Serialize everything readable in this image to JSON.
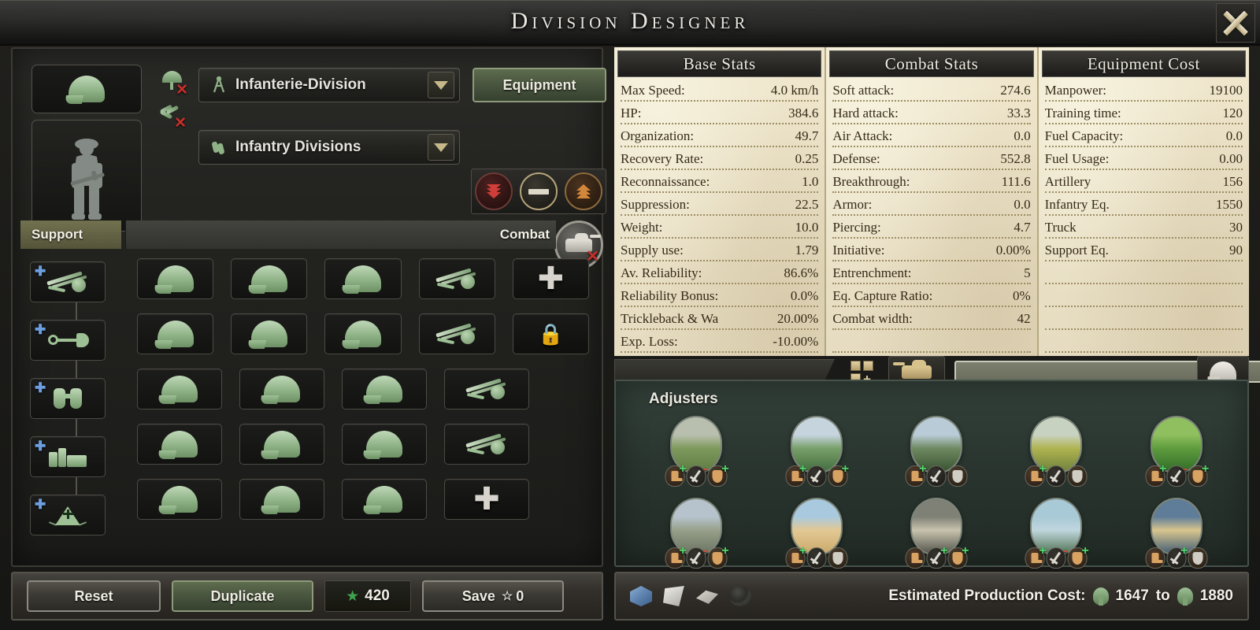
{
  "window": {
    "title": "Division Designer",
    "close_icon": "close-x-icon"
  },
  "designer": {
    "division_icon": "helmet-icon",
    "portrait": "infantry-soldier-portrait",
    "specialization_toggles": [
      {
        "name": "paratrooper-toggle",
        "icon": "parachute-icon",
        "disabled_mark": "✕"
      },
      {
        "name": "marine-toggle",
        "icon": "marine-wings-icon",
        "disabled_mark": "✕"
      }
    ],
    "template_dropdown": {
      "icon": "divider-caliper-icon",
      "value": "Infanterie-Division",
      "arrow": "chevron-down-icon"
    },
    "category_dropdown": {
      "icon": "dogtag-icon",
      "value": "Infantry Divisions",
      "arrow": "chevron-down-icon"
    },
    "equipment_button": "Equipment",
    "priority_buttons": [
      {
        "name": "priority-low",
        "icon": "double-chevron-down-icon",
        "selected": false
      },
      {
        "name": "priority-normal",
        "icon": "dash-in-ring-icon",
        "selected": false
      },
      {
        "name": "priority-high",
        "icon": "double-chevron-up-icon",
        "selected": false
      }
    ],
    "tank_designer_toggle": {
      "icon": "tank-icon",
      "disabled_mark": "✕"
    },
    "tabs": {
      "support": "Support",
      "combat": "Combat"
    }
  },
  "support_column": [
    {
      "name": "support-slot-artillery",
      "icon": "artillery-icon",
      "add_badge": "✚"
    },
    {
      "name": "support-slot-engineer",
      "icon": "shovel-icon",
      "add_badge": "✚"
    },
    {
      "name": "support-slot-recon",
      "icon": "binoculars-icon",
      "add_badge": "✚"
    },
    {
      "name": "support-slot-logistics",
      "icon": "supply-crates-icon",
      "add_badge": "✚"
    },
    {
      "name": "support-slot-field-hospital",
      "icon": "medical-tent-icon",
      "add_badge": "✚"
    }
  ],
  "combat_grid": {
    "rows": [
      {
        "cells": [
          "infantry",
          "infantry",
          "infantry",
          "artillery",
          "add"
        ]
      },
      {
        "cells": [
          "infantry",
          "infantry",
          "infantry",
          "artillery",
          "locked"
        ]
      },
      {
        "cells": [
          "infantry",
          "infantry",
          "infantry",
          "artillery"
        ]
      },
      {
        "cells": [
          "infantry",
          "infantry",
          "infantry",
          "artillery"
        ]
      },
      {
        "cells": [
          "infantry",
          "infantry",
          "infantry",
          "add"
        ]
      }
    ],
    "glyphs": {
      "infantry": "helmet-icon",
      "artillery": "artillery-icon",
      "add": "✚",
      "locked": "🔒"
    }
  },
  "stats": {
    "columns": [
      {
        "title": "Base Stats",
        "rows": [
          {
            "label": "Max Speed:",
            "value": "4.0 km/h"
          },
          {
            "label": "HP:",
            "value": "384.6"
          },
          {
            "label": "Organization:",
            "value": "49.7"
          },
          {
            "label": "Recovery Rate:",
            "value": "0.25"
          },
          {
            "label": "Reconnaissance:",
            "value": "1.0"
          },
          {
            "label": "Suppression:",
            "value": "22.5"
          },
          {
            "label": "Weight:",
            "value": "10.0"
          },
          {
            "label": "Supply use:",
            "value": "1.79"
          },
          {
            "label": "Av. Reliability:",
            "value": "86.6%"
          },
          {
            "label": "Reliability Bonus:",
            "value": "0.0%"
          },
          {
            "label": "Trickleback & Wa",
            "value": "20.00%"
          },
          {
            "label": "Exp. Loss:",
            "value": "-10.00%"
          }
        ]
      },
      {
        "title": "Combat Stats",
        "rows": [
          {
            "label": "Soft attack:",
            "value": "274.6"
          },
          {
            "label": "Hard attack:",
            "value": "33.3"
          },
          {
            "label": "Air Attack:",
            "value": "0.0"
          },
          {
            "label": "Defense:",
            "value": "552.8"
          },
          {
            "label": "Breakthrough:",
            "value": "111.6"
          },
          {
            "label": "Armor:",
            "value": "0.0"
          },
          {
            "label": "Piercing:",
            "value": "4.7"
          },
          {
            "label": "Initiative:",
            "value": "0.00%"
          },
          {
            "label": "Entrenchment:",
            "value": "5"
          },
          {
            "label": "Eq. Capture Ratio:",
            "value": "0%"
          },
          {
            "label": "Combat width:",
            "value": "42"
          },
          {
            "label": "",
            "value": ""
          }
        ]
      },
      {
        "title": "Equipment Cost",
        "rows": [
          {
            "label": "Manpower:",
            "value": "19100"
          },
          {
            "label": "Training time:",
            "value": "120"
          },
          {
            "label": "Fuel Capacity:",
            "value": "0.0"
          },
          {
            "label": "Fuel Usage:",
            "value": "0.00"
          },
          {
            "label": "Artillery",
            "value": "156"
          },
          {
            "label": "Infantry Eq.",
            "value": "1550"
          },
          {
            "label": "Truck",
            "value": "30"
          },
          {
            "label": "Support Eq.",
            "value": "90"
          },
          {
            "label": "",
            "value": ""
          },
          {
            "label": "",
            "value": ""
          },
          {
            "label": "",
            "value": ""
          },
          {
            "label": "",
            "value": ""
          }
        ]
      }
    ]
  },
  "adjusters_tabbar": {
    "grid_add_icon": "grid-add-icon",
    "tank_tab_icon": "tank-icon",
    "progress_bar": "equipment-progress-bar",
    "helmet_tab_icon": "helmet-icon"
  },
  "adjusters": {
    "title": "Adjusters",
    "terrains": [
      {
        "name": "plains",
        "colors": [
          "#b8bfae",
          "#7f9a5c",
          "#5d7a42"
        ],
        "badges": [
          {
            "icon": "boot-icon",
            "sign": "+"
          },
          {
            "icon": "sword-icon",
            "sign": "-"
          },
          {
            "icon": "shield-icon",
            "sign": "+",
            "tan": true
          }
        ]
      },
      {
        "name": "hills",
        "colors": [
          "#c6d4de",
          "#79a06a",
          "#3f6b3c"
        ],
        "badges": [
          {
            "icon": "boot-icon",
            "sign": "+"
          },
          {
            "icon": "sword-icon",
            "sign": ""
          },
          {
            "icon": "shield-icon",
            "sign": "+",
            "tan": true
          }
        ]
      },
      {
        "name": "mountain",
        "colors": [
          "#b9cbd6",
          "#6f8a62",
          "#36502f"
        ],
        "badges": [
          {
            "icon": "boot-icon",
            "sign": "+"
          },
          {
            "icon": "sword-icon",
            "sign": ""
          },
          {
            "icon": "shield-icon",
            "sign": ""
          }
        ]
      },
      {
        "name": "marsh",
        "colors": [
          "#c8d2c0",
          "#b0b451",
          "#6d7f3b"
        ],
        "badges": [
          {
            "icon": "boot-icon",
            "sign": "+"
          },
          {
            "icon": "sword-icon",
            "sign": ""
          },
          {
            "icon": "shield-icon",
            "sign": ""
          }
        ]
      },
      {
        "name": "forest",
        "colors": [
          "#8fbf5e",
          "#5f9c3e",
          "#2f6b27"
        ],
        "badges": [
          {
            "icon": "boot-icon",
            "sign": "+"
          },
          {
            "icon": "sword-icon",
            "sign": "-"
          },
          {
            "icon": "shield-icon",
            "sign": "+",
            "tan": true
          }
        ]
      },
      {
        "name": "urban",
        "colors": [
          "#b6c3cc",
          "#97a08a",
          "#6a7360"
        ],
        "badges": [
          {
            "icon": "boot-icon",
            "sign": "+"
          },
          {
            "icon": "sword-icon",
            "sign": "-"
          },
          {
            "icon": "shield-icon",
            "sign": "+",
            "tan": true
          }
        ]
      },
      {
        "name": "desert",
        "colors": [
          "#a9cade",
          "#e3c894",
          "#c9a969"
        ],
        "badges": [
          {
            "icon": "boot-icon",
            "sign": "+"
          },
          {
            "icon": "sword-icon",
            "sign": ""
          },
          {
            "icon": "shield-icon",
            "sign": ""
          }
        ]
      },
      {
        "name": "fort",
        "colors": [
          "#7f8176",
          "#c8c3ae",
          "#4e5047"
        ],
        "badges": [
          {
            "icon": "boot-icon",
            "sign": ""
          },
          {
            "icon": "sword-icon",
            "sign": "+"
          },
          {
            "icon": "shield-icon",
            "sign": "+",
            "tan": true
          }
        ]
      },
      {
        "name": "river",
        "colors": [
          "#a8c9d6",
          "#bfd6dd",
          "#4e7050"
        ],
        "badges": [
          {
            "icon": "boot-icon",
            "sign": "+"
          },
          {
            "icon": "sword-icon",
            "sign": "-"
          },
          {
            "icon": "shield-icon",
            "sign": "+",
            "tan": true
          }
        ]
      },
      {
        "name": "amphibious",
        "colors": [
          "#5f7d99",
          "#d8c58e",
          "#3c5a74"
        ],
        "badges": [
          {
            "icon": "boot-icon",
            "sign": ""
          },
          {
            "icon": "sword-icon",
            "sign": "+"
          },
          {
            "icon": "shield-icon",
            "sign": ""
          }
        ]
      }
    ]
  },
  "footer": {
    "reset_label": "Reset",
    "duplicate_label": "Duplicate",
    "xp_star": "★",
    "xp_value": "420",
    "save_label": "Save",
    "save_star": "☆",
    "save_cost": "0",
    "resources": [
      "aluminium-icon",
      "steel-icon",
      "tungsten-icon",
      "rubber-icon"
    ],
    "production_label": "Estimated Production Cost:",
    "production_min": "1647",
    "production_sep": "to",
    "production_max": "1880"
  }
}
